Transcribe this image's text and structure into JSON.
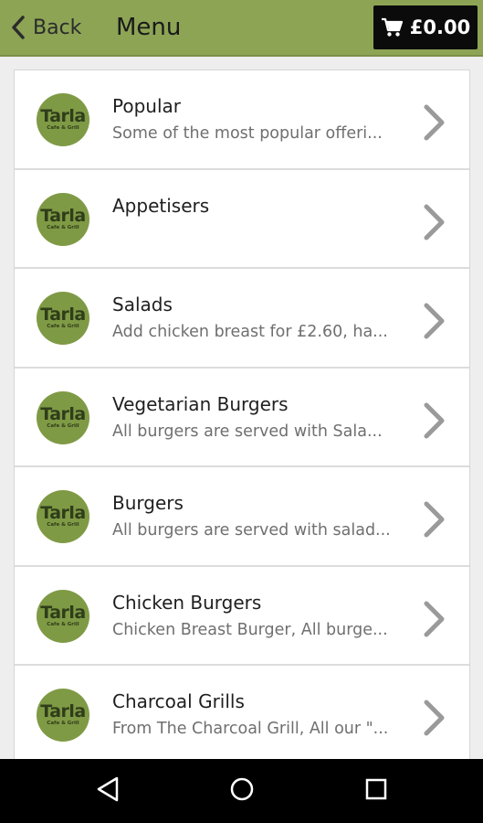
{
  "header": {
    "back_label": "Back",
    "title": "Menu",
    "cart_total": "£0.00"
  },
  "logo": {
    "line1": "Tarla",
    "line2": "Cafe & Grill"
  },
  "menu": {
    "items": [
      {
        "name": "Popular",
        "description": "Some of the most popular offeri..."
      },
      {
        "name": "Appetisers",
        "description": ""
      },
      {
        "name": "Salads",
        "description": "Add chicken breast for £2.60, ha..."
      },
      {
        "name": "Vegetarian Burgers",
        "description": "All burgers are served with Sala..."
      },
      {
        "name": "Burgers",
        "description": "All burgers are served with salad..."
      },
      {
        "name": "Chicken Burgers",
        "description": "Chicken Breast Burger, All burge..."
      },
      {
        "name": "Charcoal Grills",
        "description": "From The Charcoal Grill, All our \"..."
      }
    ]
  },
  "icons": {
    "back": "chevron-left-icon",
    "cart": "shopping-cart-icon",
    "row_arrow": "chevron-right-icon",
    "nav_back": "triangle-back-icon",
    "nav_home": "circle-home-icon",
    "nav_recents": "square-recents-icon"
  },
  "colors": {
    "header_bg": "#8da455",
    "cart_bg": "#0b0b0b",
    "logo_bg": "#7f9a45"
  }
}
